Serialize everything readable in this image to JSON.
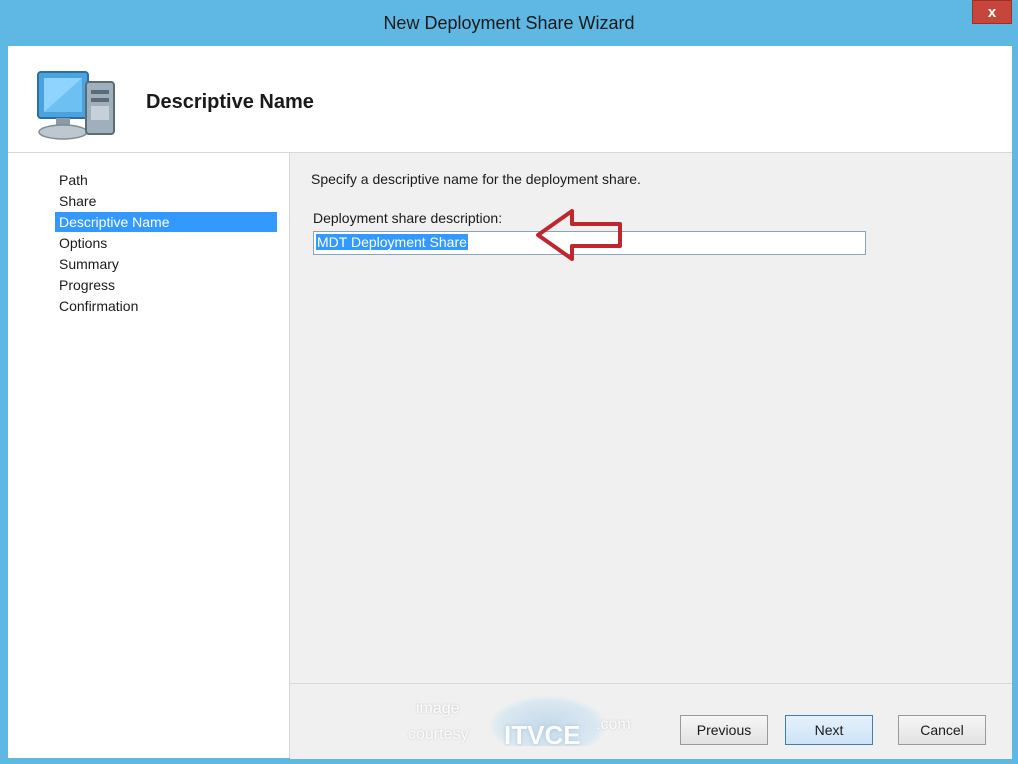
{
  "window": {
    "title": "New Deployment Share Wizard",
    "close_glyph": "x"
  },
  "header": {
    "title": "Descriptive Name",
    "icon": "computer-icon"
  },
  "nav": {
    "items": [
      {
        "label": "Path",
        "selected": false
      },
      {
        "label": "Share",
        "selected": false
      },
      {
        "label": "Descriptive Name",
        "selected": true
      },
      {
        "label": "Options",
        "selected": false
      },
      {
        "label": "Summary",
        "selected": false
      },
      {
        "label": "Progress",
        "selected": false
      },
      {
        "label": "Confirmation",
        "selected": false
      }
    ]
  },
  "main": {
    "intro": "Specify a descriptive name for the deployment share.",
    "description_label": "Deployment share description:",
    "description_value": "MDT Deployment Share"
  },
  "footer": {
    "previous_label": "Previous",
    "next_label": "Next",
    "cancel_label": "Cancel"
  },
  "watermark": {
    "line1": "image",
    "line2": "courtesy",
    "brand": "ITVCE",
    "suffix": ".com"
  },
  "colors": {
    "frame": "#5fb7e3",
    "selection": "#3399ff",
    "annotation_arrow": "#c0262d"
  }
}
